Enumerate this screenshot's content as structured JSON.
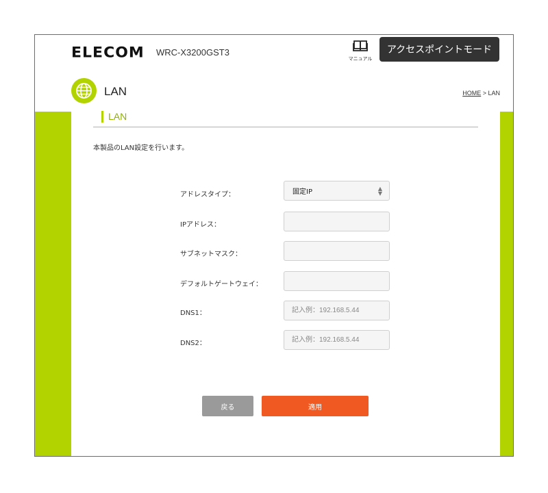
{
  "header": {
    "brand": "ELECOM",
    "model": "WRC-X3200GST3",
    "manual_label": "マニュアル",
    "mode": "アクセスポイントモード"
  },
  "page": {
    "title": "LAN",
    "breadcrumb_home": "HOME",
    "breadcrumb_sep": " > ",
    "breadcrumb_current": "LAN"
  },
  "section": {
    "title": "LAN",
    "description": "本製品のLAN設定を行います。"
  },
  "form": {
    "address_type": {
      "label": "アドレスタイプ：",
      "value": "固定IP"
    },
    "ip_address": {
      "label": "IPアドレス：",
      "value": ""
    },
    "subnet_mask": {
      "label": "サブネットマスク：",
      "value": ""
    },
    "default_gateway": {
      "label": "デフォルトゲートウェイ：",
      "value": ""
    },
    "dns1": {
      "label": "DNS1：",
      "placeholder": "記入例：192.168.5.44"
    },
    "dns2": {
      "label": "DNS2：",
      "placeholder": "記入例：192.168.5.44"
    }
  },
  "buttons": {
    "back": "戻る",
    "apply": "適用"
  },
  "colors": {
    "accent_green": "#b3d300",
    "apply_orange": "#f05a22",
    "back_gray": "#9a9a9a",
    "badge_dark": "#333333"
  }
}
